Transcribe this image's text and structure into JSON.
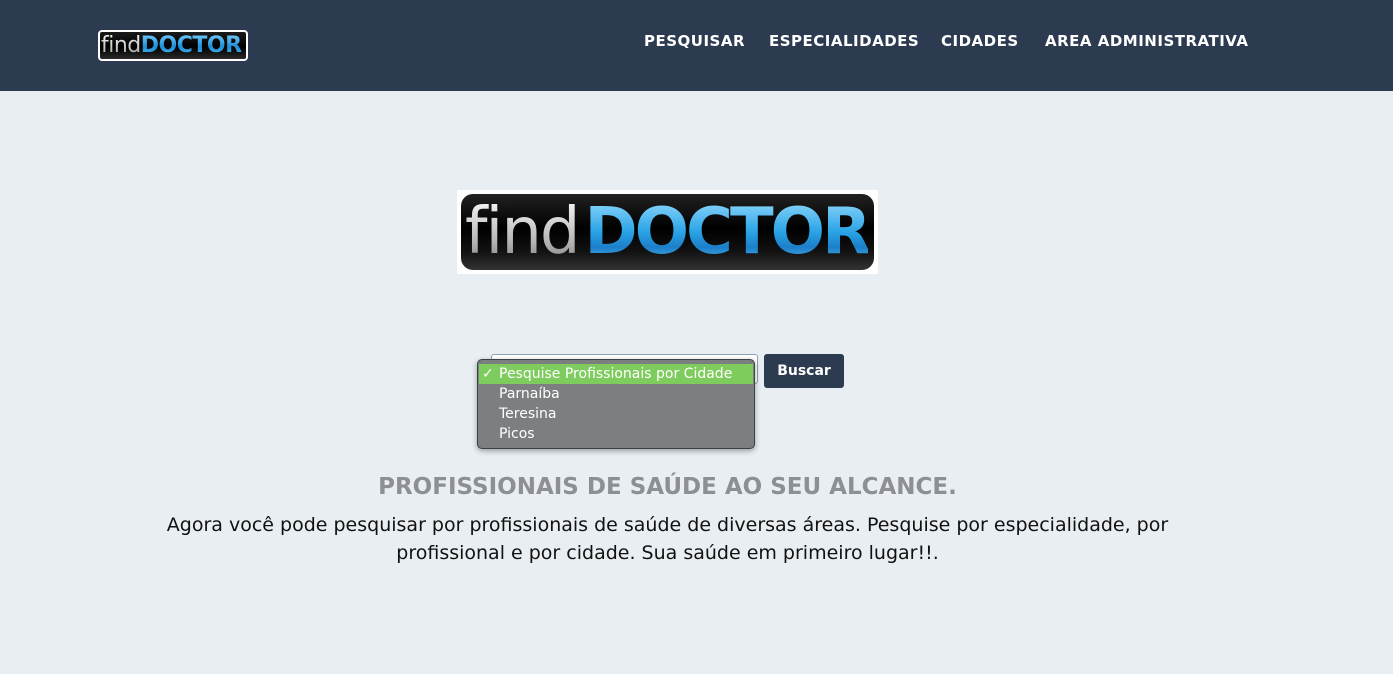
{
  "header": {
    "logo": {
      "find": "find",
      "doctor": "DOCTOR"
    },
    "nav": [
      {
        "label": "PESQUISAR"
      },
      {
        "label": "ESPECIALIDADES"
      },
      {
        "label": "CIDADES"
      },
      {
        "label": "AREA ADMINISTRATIVA"
      }
    ]
  },
  "hero_logo": {
    "find": "find",
    "doctor": "DOCTOR"
  },
  "search": {
    "check_mark": "✓",
    "options": [
      {
        "label": "Pesquise Profissionais por Cidade",
        "selected": true
      },
      {
        "label": "Parnaíba",
        "selected": false
      },
      {
        "label": "Teresina",
        "selected": false
      },
      {
        "label": "Picos",
        "selected": false
      }
    ],
    "button_label": "Buscar"
  },
  "content": {
    "heading": "PROFISSIONAIS DE SAÚDE AO SEU ALCANCE.",
    "paragraph": "Agora você pode pesquisar por profissionais de saúde de diversas áreas. Pesquise por especialidade, por profissional e por cidade. Sua saúde em primeiro lugar!!."
  },
  "colors": {
    "navbar": "#2c3b50",
    "background": "#e8eef2",
    "selected_option": "#7ecb5e",
    "dropdown_bg": "#7b7f80",
    "heading": "#8d8f92"
  }
}
